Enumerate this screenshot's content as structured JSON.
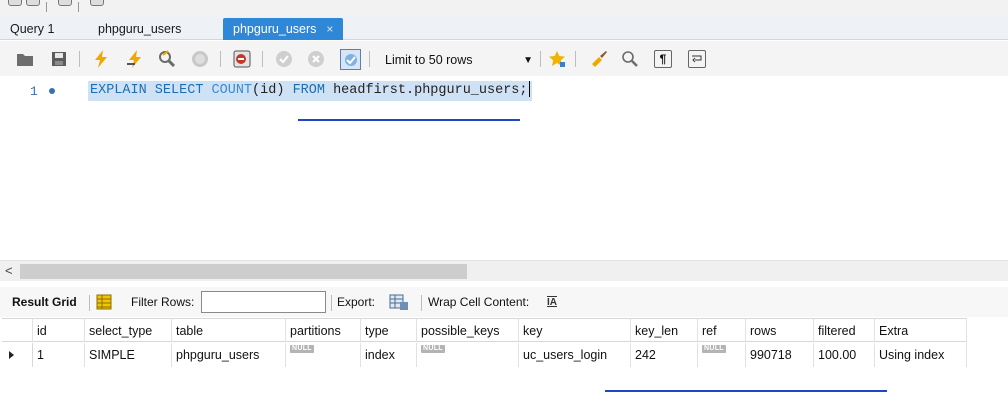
{
  "tabs": [
    {
      "label": "Query 1",
      "active": false
    },
    {
      "label": "phpguru_users",
      "active": false
    },
    {
      "label": "phpguru_users",
      "active": true,
      "close": "×"
    }
  ],
  "toolbar": {
    "limit_label": "Limit to 50 rows",
    "icons": [
      "open-folder-icon",
      "save-icon",
      "execute-lightning-icon",
      "execute-current-icon",
      "explain-magnifier-icon",
      "stop-icon",
      "toggle-error-icon",
      "commit-icon",
      "rollback-icon",
      "autocommit-icon",
      "favorites-star-icon",
      "beautify-brush-icon",
      "find-icon",
      "invisible-chars-icon",
      "wrap-icon"
    ]
  },
  "editor": {
    "line_number": "1",
    "code": {
      "kw1": "EXPLAIN SELECT",
      "fn": "COUNT",
      "args": "(id)",
      "kw2": "FROM",
      "table": "headfirst.phpguru_users;"
    }
  },
  "scrollbar": {
    "left_arrow": "<"
  },
  "result_toolbar": {
    "result_grid": "Result Grid",
    "filter_rows": "Filter Rows:",
    "export": "Export:",
    "wrap_cell": "Wrap Cell Content:",
    "wrap_icon_glyph": "IA"
  },
  "grid": {
    "columns": [
      "id",
      "select_type",
      "table",
      "partitions",
      "type",
      "possible_keys",
      "key",
      "key_len",
      "ref",
      "rows",
      "filtered",
      "Extra"
    ],
    "rows": [
      [
        "1",
        "SIMPLE",
        "phpguru_users",
        "NULL",
        "index",
        "NULL",
        "uc_users_login",
        "242",
        "NULL",
        "990718",
        "100.00",
        "Using index"
      ]
    ],
    "null_label": "NULL"
  },
  "colors": {
    "active_tab": "#2f87d8",
    "keyword": "#1a6fb3",
    "selection": "#cfe2f5",
    "annotation_underline": "#2046c8"
  }
}
